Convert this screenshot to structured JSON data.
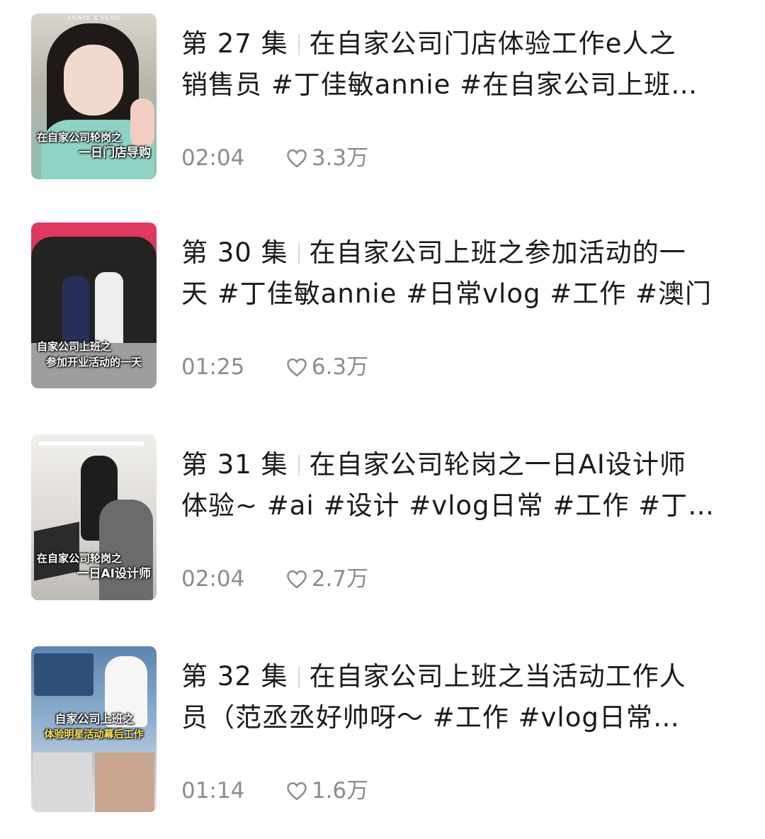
{
  "videos": [
    {
      "episode": "第 27 集",
      "title_line1": "在自家公司门店体验工作e人之",
      "title_line2": "销售员 #丁佳敏annie #在自家公司上班…",
      "duration": "02:04",
      "likes": "3.3万",
      "thumb_caption_line1": "在自家公司轮岗之",
      "thumb_caption_line2": "一日门店导购",
      "thumb_watermark": "ANNIE X VLOG",
      "colors": {
        "bg": "#c9c6bf",
        "accent": "#8fd3c7"
      }
    },
    {
      "episode": "第 30 集",
      "title_line1": "在自家公司上班之参加活动的一",
      "title_line2": "天 #丁佳敏annie #日常vlog #工作 #澳门",
      "duration": "01:25",
      "likes": "6.3万",
      "thumb_caption_line1": "自家公司上班之",
      "thumb_caption_line2": "参加开业活动的一天",
      "colors": {
        "bg": "#d8345a",
        "accent": "#1b1b1b"
      }
    },
    {
      "episode": "第 31 集",
      "title_line1": "在自家公司轮岗之一日AI设计师",
      "title_line2": "体验~ #ai #设计 #vlog日常 #工作 #丁…",
      "duration": "02:04",
      "likes": "2.7万",
      "thumb_caption_line1": "在自家公司轮岗之",
      "thumb_caption_line2": "一日AI设计师",
      "colors": {
        "bg": "#e8e6e2",
        "accent": "#6b6b6b"
      }
    },
    {
      "episode": "第 32 集",
      "title_line1": "在自家公司上班之当活动工作人",
      "title_line2": "员（范丞丞好帅呀～ #工作 #vlog日常…",
      "duration": "01:14",
      "likes": "1.6万",
      "thumb_caption_line1": "自家公司上班之",
      "thumb_caption_line2": "体验明星活动幕后工作",
      "colors": {
        "bg": "#5b7fa8",
        "accent": "#ffe55c"
      }
    }
  ],
  "icons": {
    "like": "heart-outline-icon"
  },
  "colors": {
    "text": "#1a1a1a",
    "meta": "#8c8c8c",
    "divider": "#d9d9d9"
  }
}
